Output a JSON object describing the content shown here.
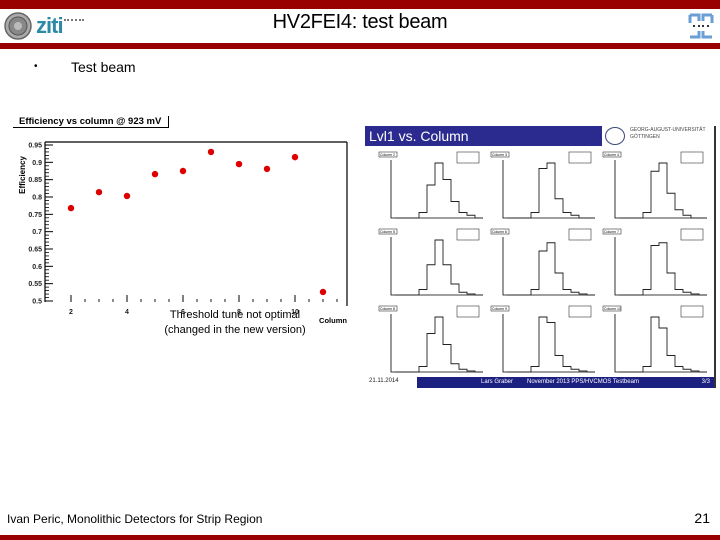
{
  "header": {
    "title": "HV2FEI4: test beam",
    "logo_left_text": "ziti",
    "colors": {
      "bar": "#990000",
      "logo_blue": "#2c8aa6"
    }
  },
  "body": {
    "bullet_symbol": "•",
    "bullet_text": "Test beam",
    "annotation_line1": "Threshold tune not optimal",
    "annotation_line2": "(changed in the new version)"
  },
  "chart_data": {
    "type": "scatter",
    "title": "Efficiency vs column @ 923 mV",
    "xlabel": "Column",
    "ylabel": "Efficiency",
    "xlim": [
      1.5,
      12
    ],
    "ylim": [
      0.5,
      0.95
    ],
    "x_ticks": [
      2,
      4,
      6,
      8,
      10
    ],
    "y_ticks": [
      "0.95",
      "0.9",
      "0.85",
      "0.8",
      "0.75",
      "0.7",
      "0.65",
      "0.6",
      "0.55",
      "0.5"
    ],
    "y_tick_values": [
      0.95,
      0.9,
      0.85,
      0.8,
      0.75,
      0.7,
      0.65,
      0.6,
      0.55,
      0.5
    ],
    "x": [
      2,
      3,
      4,
      5,
      6,
      7,
      8,
      9,
      10,
      11
    ],
    "y": [
      0.768,
      0.814,
      0.803,
      0.866,
      0.875,
      0.93,
      0.895,
      0.881,
      0.915,
      0.526
    ],
    "marker_color": "#dd0000",
    "grid": false
  },
  "embedded_slide": {
    "title": "Lvl1 vs. Column",
    "university_line1": "GEORG-AUGUST-UNIVERSITÄT",
    "university_line2": "GÖTTINGEN",
    "footer_date": "21.11.2014",
    "footer_author": "Lars Graber",
    "footer_event": "November 2013 PPS/HVCMOS Testbeam",
    "footer_page": "3/3",
    "colors": {
      "header": "#2b2b8f",
      "footer": "#1c2080"
    },
    "histograms": [
      {
        "label": "Column 2"
      },
      {
        "label": "Column 3"
      },
      {
        "label": "Column 4"
      },
      {
        "label": "Column 5"
      },
      {
        "label": "Column 6"
      },
      {
        "label": "Column 7"
      },
      {
        "label": "Column 8"
      },
      {
        "label": "Column 9"
      },
      {
        "label": "Column 10"
      }
    ]
  },
  "footer": {
    "text": "Ivan Peric, Monolithic Detectors for Strip Region",
    "page_number": "21"
  }
}
